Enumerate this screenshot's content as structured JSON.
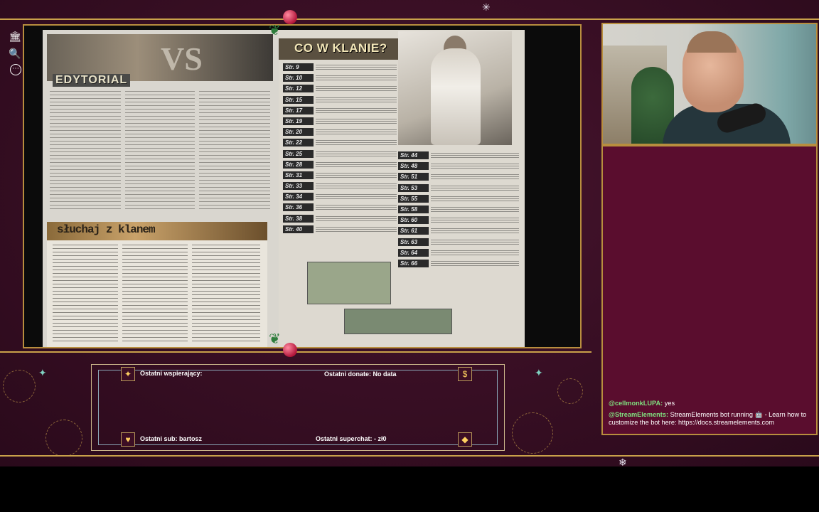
{
  "sidebar": {
    "icons": [
      {
        "name": "library-icon",
        "glyph": "🏛"
      },
      {
        "name": "search-icon",
        "glyph": "🔍"
      },
      {
        "name": "more-icon",
        "glyph": "⋯"
      }
    ]
  },
  "magazine": {
    "left_title": "EDYTORIAL",
    "vs_text": "VS",
    "sluchaj_title": "słuchaj z klanem",
    "right_title": "CO W KLANIE?",
    "pages_a": [
      "Str. 9",
      "Str. 10",
      "Str. 12",
      "Str. 15",
      "Str. 17",
      "Str. 19",
      "Str. 20",
      "Str. 22",
      "Str. 25",
      "Str. 28",
      "Str. 31",
      "Str. 33",
      "Str. 34",
      "Str. 36",
      "Str. 38",
      "Str. 40"
    ],
    "pages_b": [
      "Str. 44",
      "Str. 48",
      "Str. 51",
      "Str. 53",
      "Str. 55",
      "Str. 58",
      "Str. 60",
      "Str. 61",
      "Str. 63",
      "Str. 64",
      "Str. 66"
    ]
  },
  "chat": {
    "messages": [
      {
        "user": "@cellmonkLUPA:",
        "user_color": "#7fe07f",
        "text": " yes"
      },
      {
        "user": "@StreamElements:",
        "user_color": "#7fe07f",
        "text": " StreamElements bot running 🤖 - Learn how to customize the bot here: https://docs.streamelements.com"
      }
    ]
  },
  "panel": {
    "supporters_label": "Ostatni wspierający:",
    "donate_label": "Ostatni donate: No data",
    "sub_label": "Ostatni sub: bartosz",
    "superchat_label": "Ostatni superchat:  - zł0",
    "icons": {
      "supporter": "star-icon",
      "donate": "dollar-icon",
      "sub": "heart-icon",
      "superchat": "diamond-icon"
    }
  },
  "colors": {
    "background": "#3a0f25",
    "frame": "#c9a14a",
    "chat_bg": "#5a0d2e"
  }
}
